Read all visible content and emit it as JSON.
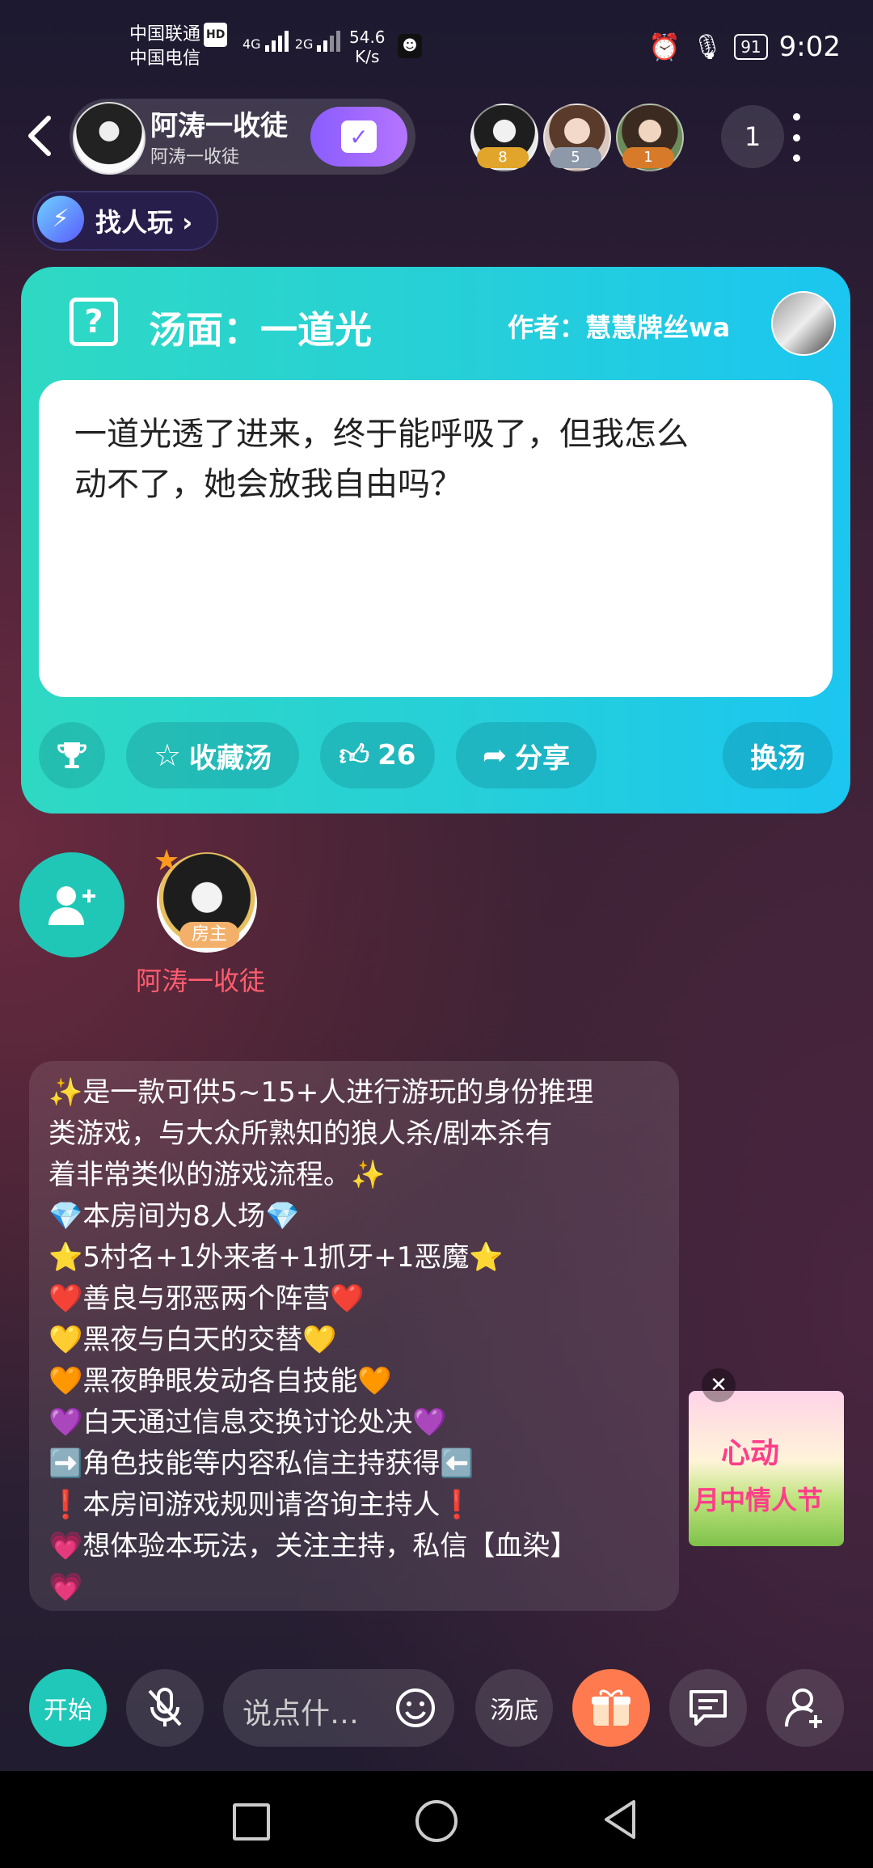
{
  "status_bar": {
    "carrier1": "中国联通",
    "carrier_hd": "HD",
    "carrier2": "中国电信",
    "net1": "4G",
    "net2": "2G",
    "speed_value": "54.6",
    "speed_unit": "K/s",
    "battery": "91",
    "time": "9:02"
  },
  "header": {
    "host_name": "阿涛一收徒",
    "host_sub": "阿涛一收徒",
    "viewers": [
      {
        "count": "8",
        "color": "#e0a52a"
      },
      {
        "count": "5",
        "color": "#8d98a8"
      },
      {
        "count": "1",
        "color": "#d77a2a"
      }
    ],
    "viewer_total": "1",
    "find_label": "找人玩"
  },
  "puzzle": {
    "title": "汤面：一道光",
    "author": "作者：慧慧牌丝wa",
    "body_line1": "一道光透了进来，终于能呼吸了，但我怎么",
    "body_line2": "动不了，她会放我自由吗？",
    "favorite_label": "收藏汤",
    "like_count": "26",
    "share_label": "分享",
    "change_label": "换汤"
  },
  "seats": {
    "owner_name": "阿涛一收徒",
    "owner_badge": "房主"
  },
  "rules": [
    "✨是一款可供5~15+人进行游玩的身份推理",
    "类游戏，与大众所熟知的狼人杀/剧本杀有",
    "着非常类似的游戏流程。✨",
    "💎本房间为8人场💎",
    "⭐5村名+1外来者+1抓牙+1恶魔⭐",
    "❤️善良与邪恶两个阵营❤️",
    "💛黑夜与白天的交替💛",
    "🧡黑夜睁眼发动各自技能🧡",
    "💜白天通过信息交换讨论处决💜",
    "➡️角色技能等内容私信主持获得⬅️",
    "❗本房间游戏规则请咨询主持人❗",
    "💗想体验本玩法，关注主持，私信【血染】",
    "💗"
  ],
  "ad": {
    "line1": "心动",
    "line2": "月中情人节"
  },
  "toolbar": {
    "start_label": "开始",
    "input_placeholder": "说点什…",
    "soup_label": "汤底"
  },
  "colors": {
    "card_start": "#2ed9c3",
    "card_end": "#1bc6f0",
    "accent_teal": "#1fc8b8",
    "owner_name": "#ff5d6f",
    "gift": "#ff7a4e"
  }
}
